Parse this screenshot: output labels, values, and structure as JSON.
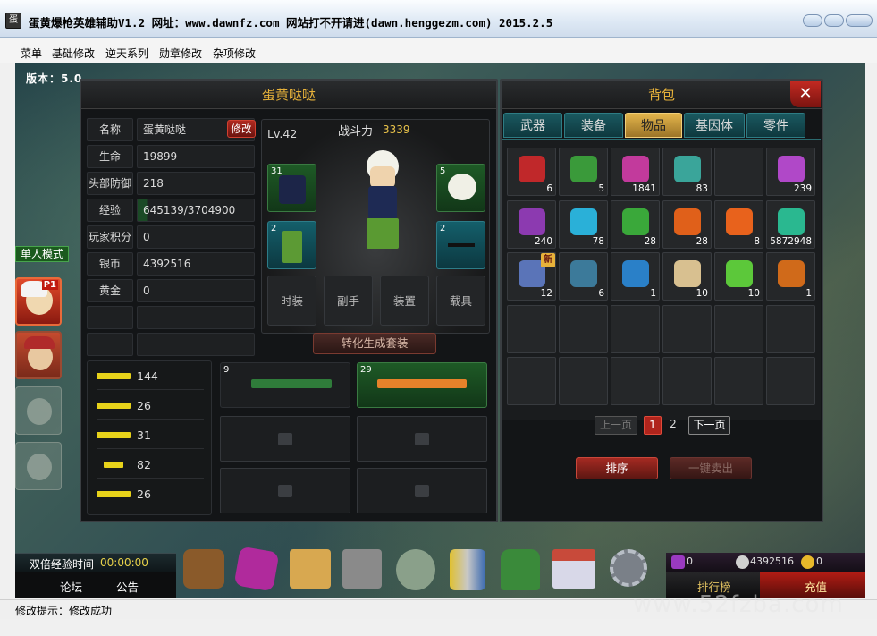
{
  "window": {
    "title": "蛋黄爆枪英雄辅助V1.2 网址：www.dawnfz.com 网站打不开请进(dawn.henggezm.com) 2015.2.5"
  },
  "menu": [
    "菜单",
    "基础修改",
    "逆天系列",
    "勋章修改",
    "杂项修改"
  ],
  "game": {
    "version": "版本：5.0"
  },
  "character": {
    "panel_title": "蛋黄哒哒",
    "modify_label": "修改",
    "fields": [
      {
        "label": "名称",
        "value": "蛋黄哒哒"
      },
      {
        "label": "生命",
        "value": "19899"
      },
      {
        "label": "头部防御",
        "value": "218"
      },
      {
        "label": "经验",
        "value": "645139/3704900"
      },
      {
        "label": "玩家积分",
        "value": "0"
      },
      {
        "label": "银币",
        "value": "4392516"
      },
      {
        "label": "黄金",
        "value": "0"
      },
      {
        "label": "",
        "value": ""
      },
      {
        "label": "",
        "value": ""
      }
    ],
    "level": "Lv.42",
    "power_label": "战斗力",
    "power_value": "3339",
    "slot_counts": [
      "31",
      "5",
      "2",
      "2"
    ],
    "equip_buttons": [
      "时装",
      "副手",
      "装置",
      "载具"
    ],
    "convert_label": "转化生成套装",
    "weapons": [
      "144",
      "26",
      "31",
      "82",
      "26"
    ],
    "gun_slot_counts": [
      "9",
      "29"
    ]
  },
  "bag": {
    "title": "背包",
    "tabs": [
      "武器",
      "装备",
      "物品",
      "基因体",
      "零件"
    ],
    "active_tab": 2,
    "items": [
      {
        "count": "6",
        "color": "#c0282a",
        "icon": "potion-icon"
      },
      {
        "count": "5",
        "color": "#3a9a3a",
        "icon": "green-crate-icon"
      },
      {
        "count": "1841",
        "color": "#c23a9c",
        "icon": "pink-gem-icon"
      },
      {
        "count": "83",
        "color": "#3aa59a",
        "icon": "rune-gem-icon"
      },
      {
        "count": "",
        "color": "",
        "icon": ""
      },
      {
        "count": "239",
        "color": "#b048c8",
        "icon": "purple-box-icon"
      },
      {
        "count": "240",
        "color": "#8c3ab0",
        "icon": "purple-chest-icon"
      },
      {
        "count": "78",
        "color": "#2ab0d8",
        "icon": "exp-card-icon"
      },
      {
        "count": "28",
        "color": "#3aa83a",
        "icon": "r-card-icon"
      },
      {
        "count": "28",
        "color": "#e0601a",
        "icon": "orange-ticket-icon"
      },
      {
        "count": "8",
        "color": "#e8621c",
        "icon": "orange-gem-icon"
      },
      {
        "count": "5872948",
        "color": "#2ab890",
        "icon": "teal-gem-icon"
      },
      {
        "count": "12",
        "color": "#5a74b8",
        "icon": "box-eyes-icon"
      },
      {
        "count": "6",
        "color": "#3c7a9a",
        "icon": "steel-crate-icon"
      },
      {
        "count": "1",
        "color": "#2a80c8",
        "icon": "blue-card-icon"
      },
      {
        "count": "10",
        "color": "#d8c090",
        "icon": "scroll-icon"
      },
      {
        "count": "10",
        "color": "#5cc83a",
        "icon": "syringe-icon"
      },
      {
        "count": "1",
        "color": "#d06a1a",
        "icon": "orange-potion-icon"
      }
    ],
    "new_badge": "新",
    "prev_page": "上一页",
    "pages": [
      "1",
      "2"
    ],
    "next_page": "下一页",
    "sort_label": "排序",
    "sell_label": "一键卖出"
  },
  "sidebar": {
    "mode": "单人模式",
    "p1": "P1"
  },
  "bottom": {
    "double_exp_label": "双倍经验时间",
    "double_exp_time": "00:00:00",
    "forum": "论坛",
    "notice": "公告",
    "purple_count": "0",
    "silver_count": "4392516",
    "gold_count": "0",
    "rank": "排行榜",
    "recharge": "充值"
  },
  "status": {
    "message": "修改提示：修改成功"
  },
  "watermark": "www.52fzba.com"
}
